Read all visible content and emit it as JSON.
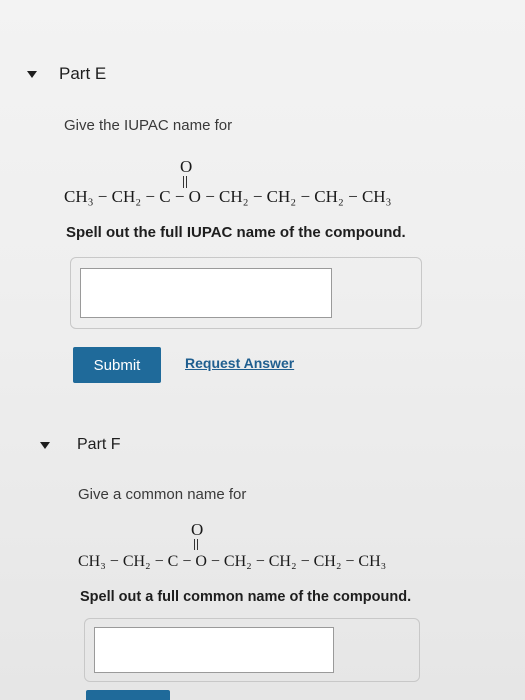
{
  "part_e": {
    "title": "Part E",
    "question": "Give the IUPAC name for",
    "formula_main": "CH₃ − CH₂ − C − O − CH₂ − CH₂ − CH₂ − CH₃",
    "carbonyl": "O",
    "instruction": "Spell out the full IUPAC name of the compound.",
    "answer_value": "",
    "submit_label": "Submit",
    "request_answer_label": "Request Answer"
  },
  "part_f": {
    "title": "Part F",
    "question": "Give a common name for",
    "formula_main": "CH₃ − CH₂ − C − O − CH₂ − CH₂ − CH₂ − CH₃",
    "carbonyl": "O",
    "instruction": "Spell out a full common name of the compound.",
    "answer_value": ""
  },
  "colors": {
    "accent": "#1f6a9a",
    "link": "#1f5e8f"
  }
}
